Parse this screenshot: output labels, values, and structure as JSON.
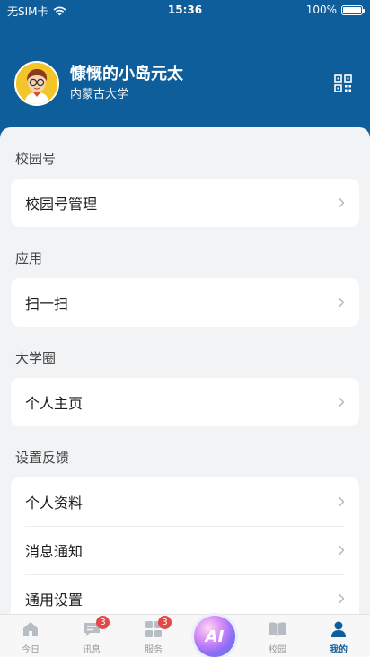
{
  "status_bar": {
    "carrier": "无SIM卡",
    "time": "15:36",
    "battery": "100%"
  },
  "profile": {
    "name": "慷慨的小岛元太",
    "school": "内蒙古大学"
  },
  "sections": [
    {
      "title": "校园号",
      "items": [
        {
          "label": "校园号管理"
        }
      ]
    },
    {
      "title": "应用",
      "items": [
        {
          "label": "扫一扫"
        }
      ]
    },
    {
      "title": "大学圈",
      "items": [
        {
          "label": "个人主页"
        }
      ]
    },
    {
      "title": "设置反馈",
      "items": [
        {
          "label": "个人资料"
        },
        {
          "label": "消息通知"
        },
        {
          "label": "通用设置"
        }
      ]
    }
  ],
  "tabbar": {
    "today": {
      "label": "今日"
    },
    "messages": {
      "label": "讯息",
      "badge": "3"
    },
    "services": {
      "label": "服务",
      "badge": "3"
    },
    "ai": {
      "label": "AI"
    },
    "campus": {
      "label": "校园"
    },
    "mine": {
      "label": "我的"
    }
  },
  "colors": {
    "brand": "#0f5e9c",
    "badge": "#e24a4a",
    "background": "#f2f3f5"
  }
}
